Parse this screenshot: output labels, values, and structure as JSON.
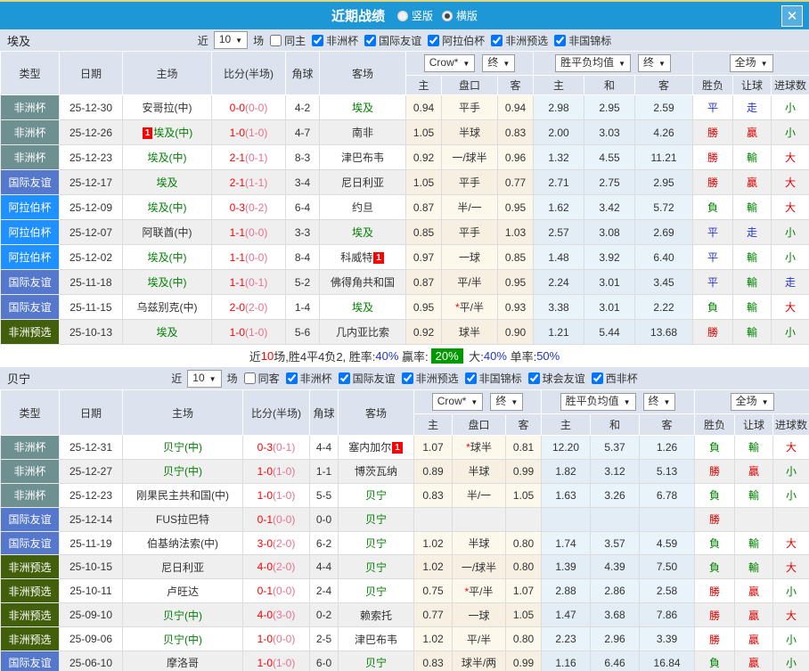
{
  "titlebar": {
    "title": "近期战绩",
    "radio_vertical": "竖版",
    "radio_horizontal": "横版",
    "selected_layout": "横版",
    "close": "✕"
  },
  "colors": {
    "titlebar_bg": "#1e97d6",
    "top_line": "#e5d67c",
    "header_bg": "#dce3ee",
    "win": "#dd0000",
    "lose": "#008000",
    "draw": "#2336cc",
    "summary_highlight": "#009900",
    "type": {
      "非洲杯": "#6e9090",
      "国际友谊": "#5577cc",
      "阿拉伯杯": "#1e90ff",
      "非洲预选": "#42600b"
    }
  },
  "sections": [
    {
      "team": "埃及",
      "filter": {
        "near": "近",
        "count": "10",
        "games": "场",
        "same": "同主",
        "same_checked": false,
        "comps": [
          {
            "label": "非洲杯",
            "checked": true
          },
          {
            "label": "国际友谊",
            "checked": true
          },
          {
            "label": "阿拉伯杯",
            "checked": true
          },
          {
            "label": "非洲预选",
            "checked": true
          },
          {
            "label": "非国锦标",
            "checked": true
          }
        ]
      },
      "header": {
        "type": "类型",
        "date": "日期",
        "home": "主场",
        "score": "比分(半场)",
        "corner": "角球",
        "away": "客场",
        "odds_dd": "Crow*",
        "odds_fin": "终",
        "odds_home": "主",
        "odds_hc": "盘口",
        "odds_away": "客",
        "avg_dd": "胜平负均值",
        "avg_fin": "终",
        "avg_home": "主",
        "avg_draw": "和",
        "avg_away": "客",
        "full_dd": "全场",
        "res_wl": "胜负",
        "res_hc": "让球",
        "res_goals": "进球数"
      },
      "rows": [
        {
          "type": "非洲杯",
          "date": "25-12-30",
          "home": "安哥拉(中)",
          "home_green": false,
          "home_badge": false,
          "score": "0-0",
          "half": "(0-0)",
          "corner": "4-2",
          "away": "埃及",
          "away_green": true,
          "away_badge": false,
          "o1": "0.94",
          "hc": "平手",
          "hc_star": false,
          "o2": "0.94",
          "m1": "2.98",
          "m2": "2.95",
          "m3": "2.59",
          "r1": "平",
          "r2": "走",
          "r3": "小"
        },
        {
          "type": "非洲杯",
          "date": "25-12-26",
          "home": "埃及(中)",
          "home_green": true,
          "home_badge": true,
          "score": "1-0",
          "half": "(1-0)",
          "corner": "4-7",
          "away": "南非",
          "away_green": false,
          "away_badge": false,
          "o1": "1.05",
          "hc": "半球",
          "hc_star": false,
          "o2": "0.83",
          "m1": "2.00",
          "m2": "3.03",
          "m3": "4.26",
          "r1": "勝",
          "r2": "贏",
          "r3": "小"
        },
        {
          "type": "非洲杯",
          "date": "25-12-23",
          "home": "埃及(中)",
          "home_green": true,
          "home_badge": false,
          "score": "2-1",
          "half": "(0-1)",
          "corner": "8-3",
          "away": "津巴布韦",
          "away_green": false,
          "away_badge": false,
          "o1": "0.92",
          "hc": "一/球半",
          "hc_star": false,
          "o2": "0.96",
          "m1": "1.32",
          "m2": "4.55",
          "m3": "11.21",
          "r1": "勝",
          "r2": "輸",
          "r3": "大"
        },
        {
          "type": "国际友谊",
          "date": "25-12-17",
          "home": "埃及",
          "home_green": true,
          "home_badge": false,
          "score": "2-1",
          "half": "(1-1)",
          "corner": "3-4",
          "away": "尼日利亚",
          "away_green": false,
          "away_badge": false,
          "o1": "1.05",
          "hc": "平手",
          "hc_star": false,
          "o2": "0.77",
          "m1": "2.71",
          "m2": "2.75",
          "m3": "2.95",
          "r1": "勝",
          "r2": "贏",
          "r3": "大"
        },
        {
          "type": "阿拉伯杯",
          "date": "25-12-09",
          "home": "埃及(中)",
          "home_green": true,
          "home_badge": false,
          "score": "0-3",
          "half": "(0-2)",
          "corner": "6-4",
          "away": "约旦",
          "away_green": false,
          "away_badge": false,
          "o1": "0.87",
          "hc": "半/一",
          "hc_star": false,
          "o2": "0.95",
          "m1": "1.62",
          "m2": "3.42",
          "m3": "5.72",
          "r1": "負",
          "r2": "輸",
          "r3": "大"
        },
        {
          "type": "阿拉伯杯",
          "date": "25-12-07",
          "home": "阿联酋(中)",
          "home_green": false,
          "home_badge": false,
          "score": "1-1",
          "half": "(0-0)",
          "corner": "3-3",
          "away": "埃及",
          "away_green": true,
          "away_badge": false,
          "o1": "0.85",
          "hc": "平手",
          "hc_star": false,
          "o2": "1.03",
          "m1": "2.57",
          "m2": "3.08",
          "m3": "2.69",
          "r1": "平",
          "r2": "走",
          "r3": "小"
        },
        {
          "type": "阿拉伯杯",
          "date": "25-12-02",
          "home": "埃及(中)",
          "home_green": true,
          "home_badge": false,
          "score": "1-1",
          "half": "(0-0)",
          "corner": "8-4",
          "away": "科威特",
          "away_green": false,
          "away_badge": true,
          "o1": "0.97",
          "hc": "一球",
          "hc_star": false,
          "o2": "0.85",
          "m1": "1.48",
          "m2": "3.92",
          "m3": "6.40",
          "r1": "平",
          "r2": "輸",
          "r3": "小"
        },
        {
          "type": "国际友谊",
          "date": "25-11-18",
          "home": "埃及(中)",
          "home_green": true,
          "home_badge": false,
          "score": "1-1",
          "half": "(0-1)",
          "corner": "5-2",
          "away": "佛得角共和国",
          "away_green": false,
          "away_badge": false,
          "o1": "0.87",
          "hc": "平/半",
          "hc_star": false,
          "o2": "0.95",
          "m1": "2.24",
          "m2": "3.01",
          "m3": "3.45",
          "r1": "平",
          "r2": "輸",
          "r3": "走"
        },
        {
          "type": "国际友谊",
          "date": "25-11-15",
          "home": "乌兹别克(中)",
          "home_green": false,
          "home_badge": false,
          "score": "2-0",
          "half": "(2-0)",
          "corner": "1-4",
          "away": "埃及",
          "away_green": true,
          "away_badge": false,
          "o1": "0.95",
          "hc": "平/半",
          "hc_star": true,
          "o2": "0.93",
          "m1": "3.38",
          "m2": "3.01",
          "m3": "2.22",
          "r1": "負",
          "r2": "輸",
          "r3": "大"
        },
        {
          "type": "非洲预选",
          "date": "25-10-13",
          "home": "埃及",
          "home_green": true,
          "home_badge": false,
          "score": "1-0",
          "half": "(1-0)",
          "corner": "5-6",
          "away": "几内亚比索",
          "away_green": false,
          "away_badge": false,
          "o1": "0.92",
          "hc": "球半",
          "hc_star": false,
          "o2": "0.90",
          "m1": "1.21",
          "m2": "5.44",
          "m3": "13.68",
          "r1": "勝",
          "r2": "輸",
          "r3": "小"
        }
      ],
      "summary": {
        "parts": [
          {
            "text": "近",
            "style": "plain"
          },
          {
            "text": "10",
            "style": "red"
          },
          {
            "text": "场,胜4平4负2, 胜率:",
            "style": "plain"
          },
          {
            "text": "40%",
            "style": "blue"
          },
          {
            "text": " 贏率:",
            "style": "plain"
          },
          {
            "text": "20%",
            "style": "greenbox"
          },
          {
            "text": " 大:",
            "style": "plain"
          },
          {
            "text": "40%",
            "style": "blue"
          },
          {
            "text": " 单率:",
            "style": "plain"
          },
          {
            "text": "50%",
            "style": "blue"
          }
        ]
      }
    },
    {
      "team": "贝宁",
      "filter": {
        "near": "近",
        "count": "10",
        "games": "场",
        "same": "同客",
        "same_checked": false,
        "comps": [
          {
            "label": "非洲杯",
            "checked": true
          },
          {
            "label": "国际友谊",
            "checked": true
          },
          {
            "label": "非洲预选",
            "checked": true
          },
          {
            "label": "非国锦标",
            "checked": true
          },
          {
            "label": "球会友谊",
            "checked": true
          },
          {
            "label": "西非杯",
            "checked": true
          }
        ]
      },
      "header": {
        "type": "类型",
        "date": "日期",
        "home": "主场",
        "score": "比分(半场)",
        "corner": "角球",
        "away": "客场",
        "odds_dd": "Crow*",
        "odds_fin": "终",
        "odds_home": "主",
        "odds_hc": "盘口",
        "odds_away": "客",
        "avg_dd": "胜平负均值",
        "avg_fin": "终",
        "avg_home": "主",
        "avg_draw": "和",
        "avg_away": "客",
        "full_dd": "全场",
        "res_wl": "胜负",
        "res_hc": "让球",
        "res_goals": "进球数"
      },
      "rows": [
        {
          "type": "非洲杯",
          "date": "25-12-31",
          "home": "贝宁(中)",
          "home_green": true,
          "home_badge": false,
          "score": "0-3",
          "half": "(0-1)",
          "corner": "4-4",
          "away": "塞内加尔",
          "away_green": false,
          "away_badge": true,
          "o1": "1.07",
          "hc": "球半",
          "hc_star": true,
          "o2": "0.81",
          "m1": "12.20",
          "m2": "5.37",
          "m3": "1.26",
          "r1": "負",
          "r2": "輸",
          "r3": "大"
        },
        {
          "type": "非洲杯",
          "date": "25-12-27",
          "home": "贝宁(中)",
          "home_green": true,
          "home_badge": false,
          "score": "1-0",
          "half": "(1-0)",
          "corner": "1-1",
          "away": "博茨瓦纳",
          "away_green": false,
          "away_badge": false,
          "o1": "0.89",
          "hc": "半球",
          "hc_star": false,
          "o2": "0.99",
          "m1": "1.82",
          "m2": "3.12",
          "m3": "5.13",
          "r1": "勝",
          "r2": "贏",
          "r3": "小"
        },
        {
          "type": "非洲杯",
          "date": "25-12-23",
          "home": "刚果民主共和国(中)",
          "home_green": false,
          "home_badge": false,
          "score": "1-0",
          "half": "(1-0)",
          "corner": "5-5",
          "away": "贝宁",
          "away_green": true,
          "away_badge": false,
          "o1": "0.83",
          "hc": "半/一",
          "hc_star": false,
          "o2": "1.05",
          "m1": "1.63",
          "m2": "3.26",
          "m3": "6.78",
          "r1": "負",
          "r2": "輸",
          "r3": "小"
        },
        {
          "type": "国际友谊",
          "date": "25-12-14",
          "home": "FUS拉巴特",
          "home_green": false,
          "home_badge": false,
          "score": "0-1",
          "half": "(0-0)",
          "corner": "0-0",
          "away": "贝宁",
          "away_green": true,
          "away_badge": false,
          "o1": "",
          "hc": "",
          "hc_star": false,
          "o2": "",
          "m1": "",
          "m2": "",
          "m3": "",
          "r1": "勝",
          "r2": "",
          "r3": ""
        },
        {
          "type": "国际友谊",
          "date": "25-11-19",
          "home": "伯基纳法索(中)",
          "home_green": false,
          "home_badge": false,
          "score": "3-0",
          "half": "(2-0)",
          "corner": "6-2",
          "away": "贝宁",
          "away_green": true,
          "away_badge": false,
          "o1": "1.02",
          "hc": "半球",
          "hc_star": false,
          "o2": "0.80",
          "m1": "1.74",
          "m2": "3.57",
          "m3": "4.59",
          "r1": "負",
          "r2": "輸",
          "r3": "大"
        },
        {
          "type": "非洲预选",
          "date": "25-10-15",
          "home": "尼日利亚",
          "home_green": false,
          "home_badge": false,
          "score": "4-0",
          "half": "(2-0)",
          "corner": "4-4",
          "away": "贝宁",
          "away_green": true,
          "away_badge": false,
          "o1": "1.02",
          "hc": "一/球半",
          "hc_star": false,
          "o2": "0.80",
          "m1": "1.39",
          "m2": "4.39",
          "m3": "7.50",
          "r1": "負",
          "r2": "輸",
          "r3": "大"
        },
        {
          "type": "非洲预选",
          "date": "25-10-11",
          "home": "卢旺达",
          "home_green": false,
          "home_badge": false,
          "score": "0-1",
          "half": "(0-0)",
          "corner": "2-4",
          "away": "贝宁",
          "away_green": true,
          "away_badge": false,
          "o1": "0.75",
          "hc": "平/半",
          "hc_star": true,
          "o2": "1.07",
          "m1": "2.88",
          "m2": "2.86",
          "m3": "2.58",
          "r1": "勝",
          "r2": "贏",
          "r3": "小"
        },
        {
          "type": "非洲预选",
          "date": "25-09-10",
          "home": "贝宁(中)",
          "home_green": true,
          "home_badge": false,
          "score": "4-0",
          "half": "(3-0)",
          "corner": "0-2",
          "away": "赖索托",
          "away_green": false,
          "away_badge": false,
          "o1": "0.77",
          "hc": "一球",
          "hc_star": false,
          "o2": "1.05",
          "m1": "1.47",
          "m2": "3.68",
          "m3": "7.86",
          "r1": "勝",
          "r2": "贏",
          "r3": "大"
        },
        {
          "type": "非洲预选",
          "date": "25-09-06",
          "home": "贝宁(中)",
          "home_green": true,
          "home_badge": false,
          "score": "1-0",
          "half": "(0-0)",
          "corner": "2-5",
          "away": "津巴布韦",
          "away_green": false,
          "away_badge": false,
          "o1": "1.02",
          "hc": "平/半",
          "hc_star": false,
          "o2": "0.80",
          "m1": "2.23",
          "m2": "2.96",
          "m3": "3.39",
          "r1": "勝",
          "r2": "贏",
          "r3": "小"
        },
        {
          "type": "国际友谊",
          "date": "25-06-10",
          "home": "摩洛哥",
          "home_green": false,
          "home_badge": false,
          "score": "1-0",
          "half": "(1-0)",
          "corner": "6-0",
          "away": "贝宁",
          "away_green": true,
          "away_badge": false,
          "o1": "0.83",
          "hc": "球半/两",
          "hc_star": false,
          "o2": "0.99",
          "m1": "1.16",
          "m2": "6.46",
          "m3": "16.84",
          "r1": "負",
          "r2": "贏",
          "r3": "小"
        }
      ]
    }
  ]
}
